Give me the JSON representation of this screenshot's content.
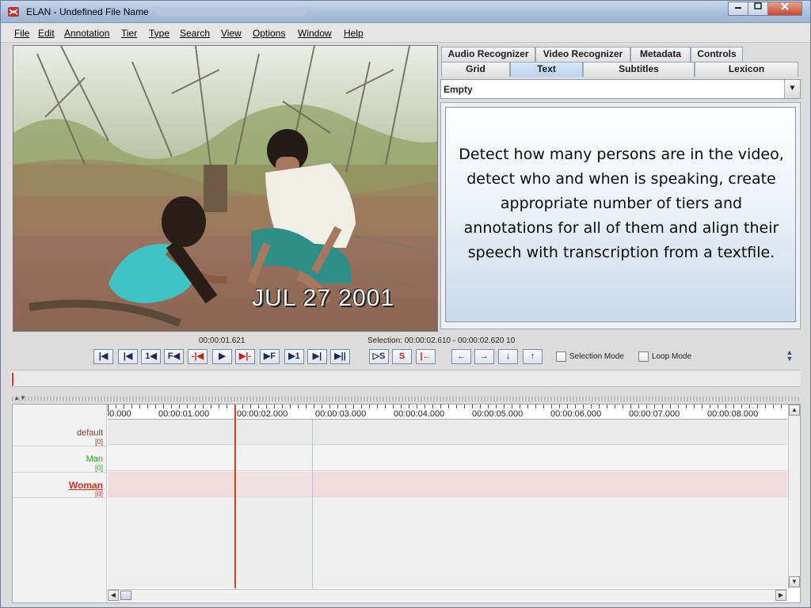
{
  "window": {
    "title": "ELAN - Undefined File Name",
    "minimize_icon": "minimize-icon",
    "maximize_icon": "maximize-icon",
    "close_icon": "close-icon"
  },
  "menu": [
    "File",
    "Edit",
    "Annotation",
    "Tier",
    "Type",
    "Search",
    "View",
    "Options",
    "Window",
    "Help"
  ],
  "video": {
    "date_stamp": "JUL 27 2001"
  },
  "tabs_top": [
    "Audio Recognizer",
    "Video Recognizer",
    "Metadata",
    "Controls"
  ],
  "tabs_bottom": [
    "Grid",
    "Text",
    "Subtitles",
    "Lexicon"
  ],
  "active_tab": "Text",
  "combo": {
    "value": "Empty"
  },
  "task_text": "Detect how many persons are in the video, detect who and when is speaking, create appropriate number of tiers and annotations for all of them and align their speech with transcription from a textfile.",
  "controls": {
    "current_time": "00:00:01.621",
    "selection": "Selection: 00:00:02.610 - 00:00:02.620  10",
    "playback_buttons": [
      "|◀",
      "|◀",
      "1◀",
      "F◀",
      "-|◀",
      "▶",
      "▶|-",
      "▶F",
      "▶1",
      "▶|",
      "▶||"
    ],
    "selection_buttons": [
      "▷S",
      "S",
      "|←"
    ],
    "nav_buttons": [
      "←",
      "→",
      "↓",
      "↑"
    ],
    "selection_mode_label": "Selection Mode",
    "loop_mode_label": "Loop Mode"
  },
  "timeline": {
    "ruler_labels": [
      "00.000",
      "00:00:01.000",
      "00:00:02.000",
      "00:00:03.000",
      "00:00:04.000",
      "00:00:05.000",
      "00:00:06.000",
      "00:00:07.000",
      "00:00:08.000"
    ],
    "tiers": [
      {
        "name": "default",
        "count": "[0]",
        "color": "#8a3a2a"
      },
      {
        "name": "Man",
        "count": "[0]",
        "color": "#2aa02a"
      },
      {
        "name": "Woman",
        "count": "[0]",
        "color": "#d02a20"
      }
    ]
  },
  "colors": {
    "active_tab": "#b9d2ec",
    "playhead": "#e03a2f",
    "woman_track": "#f2dcdc"
  }
}
